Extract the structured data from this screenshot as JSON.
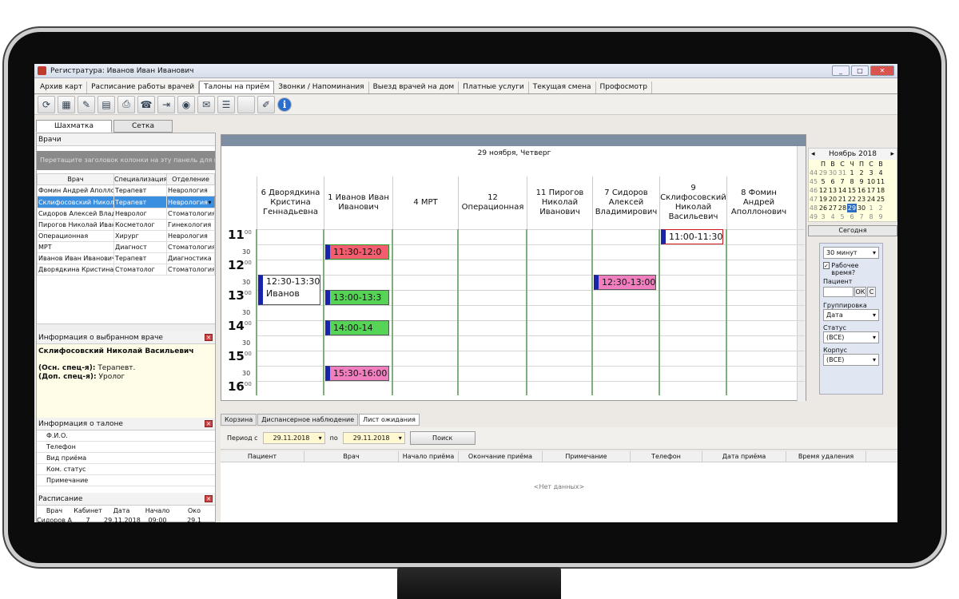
{
  "window": {
    "title": "Регистратура: Иванов Иван Иванович"
  },
  "menu": [
    "Архив карт",
    "Расписание работы врачей",
    "Талоны на приём",
    "Звонки / Напоминания",
    "Выезд врачей на дом",
    "Платные услуги",
    "Текущая смена",
    "Профосмотр"
  ],
  "menu_active_index": 2,
  "view_tabs": [
    "Шахматка",
    "Сетка"
  ],
  "doctors_panel": {
    "title": "Врачи",
    "group_hint": "Перетащите заголовок колонки на эту панель для гр",
    "columns": [
      "Врач",
      "Специализация",
      "Отделение"
    ],
    "rows": [
      [
        "Фомин Андрей Аполлс",
        "Терапевт",
        "Неврология"
      ],
      [
        "Склифосовский Никола",
        "Терапевт",
        "Неврология"
      ],
      [
        "Сидоров Алексей Влад",
        "Невролог",
        "Стоматология"
      ],
      [
        "Пирогов Николай Иван",
        "Косметолог",
        "Гинекология"
      ],
      [
        "Операционная",
        "Хирург",
        "Неврология"
      ],
      [
        "МРТ",
        "Диагност",
        "Стоматология"
      ],
      [
        "Иванов Иван Иванович",
        "Терапевт",
        "Диагностика"
      ],
      [
        "Дворядкина Кристина",
        "Стоматолог",
        "Стоматология"
      ]
    ],
    "selected_row": 1
  },
  "doctor_info": {
    "title": "Информация о выбранном враче",
    "name": "Склифосовский Николай Васильевич",
    "main_spec_label": "(Осн. спец-я):",
    "main_spec": "Терапевт.",
    "add_spec_label": "(Доп. спец-я):",
    "add_spec": "Уролог"
  },
  "talon_info": {
    "title": "Информация о талоне",
    "fields": [
      "Ф.И.О.",
      "Телефон",
      "Вид приёма",
      "Ком. статус",
      "Примечание"
    ]
  },
  "schedule_panel": {
    "title": "Расписание",
    "columns": [
      "Врач",
      "Кабинет",
      "Дата",
      "Начало",
      "Око"
    ],
    "row": [
      "Сидоров А",
      "7",
      "29.11.2018",
      "09:00",
      "29.1"
    ]
  },
  "grid": {
    "date_header": "29 ноября, Четверг",
    "columns": [
      "6 Дворядкина Кристина Геннадьевна",
      "1 Иванов Иван Иванович",
      "4 МРТ",
      "12 Операционная",
      "11 Пирогов Николай Иванович",
      "7 Сидоров Алексей Владимирович",
      "9 Склифосовский Николай Васильевич",
      "8 Фомин Андрей Аполлонович"
    ],
    "hours": [
      "11",
      "12",
      "13",
      "14",
      "15",
      "16"
    ],
    "minute_label": "00",
    "half_label": "30",
    "appointments": [
      {
        "col": 6,
        "start": "11:00",
        "label": "11:00-11:30",
        "bg": "#ffffff",
        "border": "#d01818"
      },
      {
        "col": 1,
        "start": "11:30",
        "label": "11:30-12:0",
        "bg": "#f35d6d",
        "border": "#2a9e2a"
      },
      {
        "col": 0,
        "start": "12:30",
        "label": "12:30-13:30",
        "label2": "Иванов",
        "bg": "#ffffff",
        "border": "#555555"
      },
      {
        "col": 5,
        "start": "12:30",
        "label": "12:30-13:00",
        "bg": "#f07fbf",
        "border": "#555555"
      },
      {
        "col": 1,
        "start": "13:00",
        "label": "13:00-13:3",
        "bg": "#55d455",
        "border": "#555555"
      },
      {
        "col": 1,
        "start": "14:00",
        "label": "14:00-14",
        "bg": "#55d455",
        "border": "#555555"
      },
      {
        "col": 1,
        "start": "15:30",
        "label": "15:30-16:00",
        "bg": "#f07fbf",
        "border": "#555555"
      }
    ]
  },
  "bottom_tabs": [
    "Корзина",
    "Диспансерное наблюдение",
    "Лист ожидания"
  ],
  "bottom_active_index": 2,
  "filter": {
    "period_label": "Период с",
    "from": "29.11.2018",
    "to_label": "по",
    "to": "29.11.2018",
    "search": "Поиск"
  },
  "wait_list": {
    "columns": [
      "Пациент",
      "Врач",
      "Начало приёма",
      "Окончание приёма",
      "Примечание",
      "Телефон",
      "Дата приёма",
      "Время удаления"
    ],
    "empty": "<Нет данных>"
  },
  "calendar": {
    "month": "Ноябрь 2018",
    "weekdays": [
      "П",
      "В",
      "С",
      "Ч",
      "П",
      "С",
      "В"
    ],
    "weeks": [
      {
        "wk": "44",
        "days": [
          "29",
          "30",
          "31",
          "1",
          "2",
          "3",
          "4"
        ]
      },
      {
        "wk": "45",
        "days": [
          "5",
          "6",
          "7",
          "8",
          "9",
          "10",
          "11"
        ]
      },
      {
        "wk": "46",
        "days": [
          "12",
          "13",
          "14",
          "15",
          "16",
          "17",
          "18"
        ]
      },
      {
        "wk": "47",
        "days": [
          "19",
          "20",
          "21",
          "22",
          "23",
          "24",
          "25"
        ]
      },
      {
        "wk": "48",
        "days": [
          "26",
          "27",
          "28",
          "29",
          "30",
          "1",
          "2"
        ]
      },
      {
        "wk": "49",
        "days": [
          "3",
          "4",
          "5",
          "6",
          "7",
          "8",
          "9"
        ]
      }
    ],
    "today": "Сегодня"
  },
  "options": {
    "interval": "30 минут",
    "work_time": "Рабочее время?",
    "patient_label": "Пациент",
    "ok": "ОК",
    "clear": "С",
    "grouping_label": "Группировка",
    "grouping": "Дата",
    "status_label": "Статус",
    "status": "(ВСЕ)",
    "building_label": "Корпус",
    "building": "(ВСЕ)"
  }
}
